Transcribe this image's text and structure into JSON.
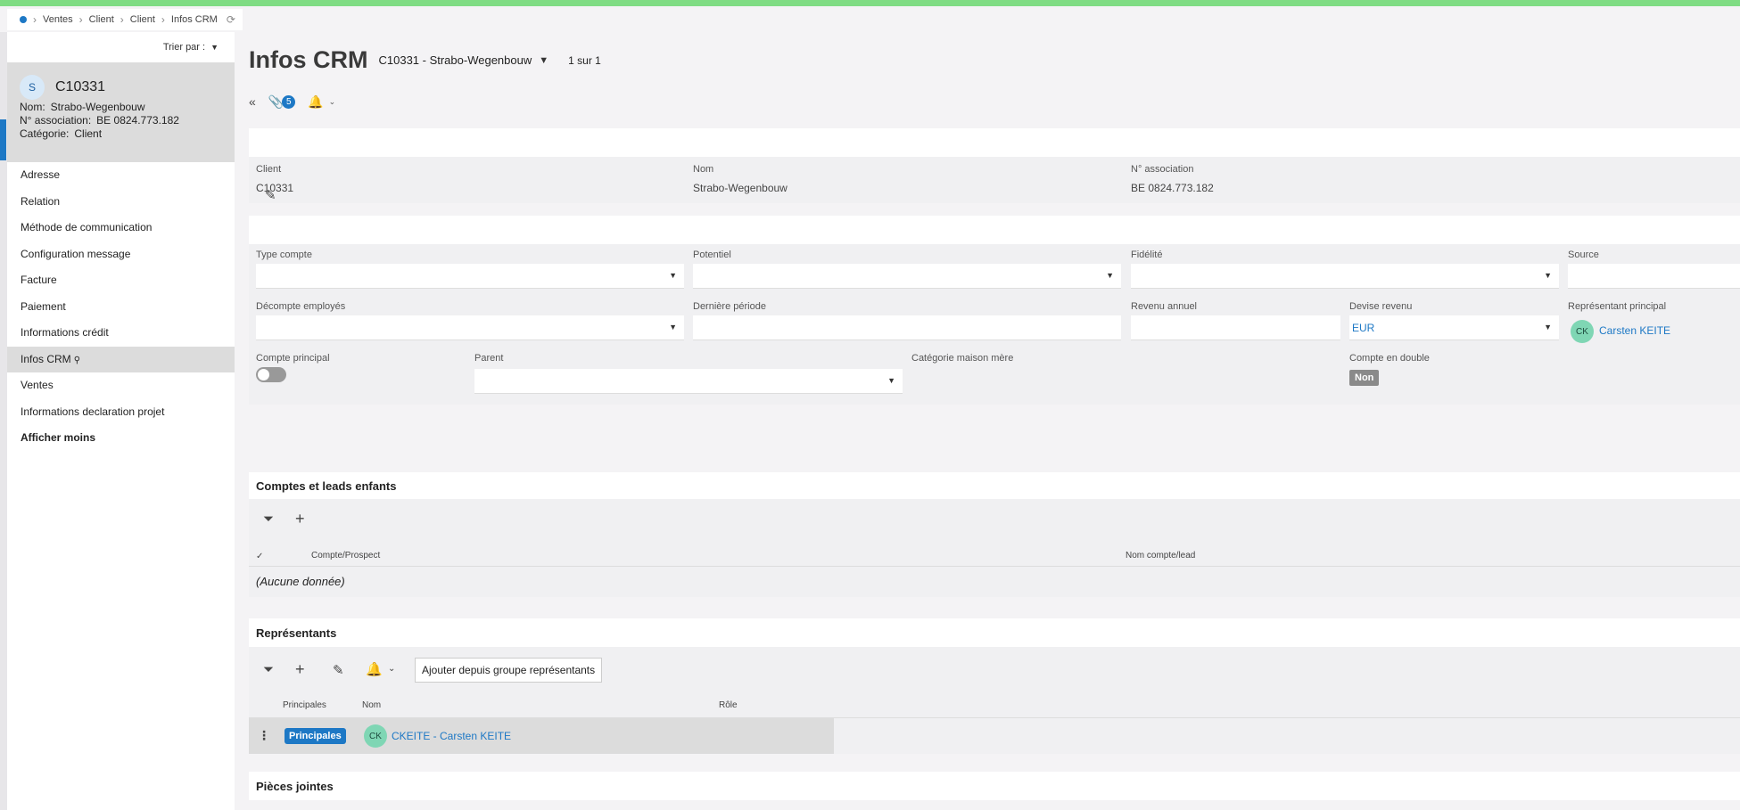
{
  "breadcrumb": [
    "Ventes",
    "Client",
    "Client",
    "Infos CRM"
  ],
  "sidebar": {
    "sort_label": "Trier par :",
    "card": {
      "avatar": "S",
      "code": "C10331",
      "rows": [
        {
          "key": "Nom:",
          "value": "Strabo-Wegenbouw"
        },
        {
          "key": "N° association:",
          "value": "BE 0824.773.182"
        },
        {
          "key": "Catégorie:",
          "value": "Client"
        }
      ]
    },
    "items": [
      {
        "label": "Adresse"
      },
      {
        "label": "Relation"
      },
      {
        "label": "Méthode de communication"
      },
      {
        "label": "Configuration message"
      },
      {
        "label": "Facture"
      },
      {
        "label": "Paiement"
      },
      {
        "label": "Informations crédit"
      },
      {
        "label": "Infos CRM"
      },
      {
        "label": "Ventes"
      },
      {
        "label": "Informations declaration projet"
      },
      {
        "label": "Afficher moins"
      }
    ]
  },
  "header": {
    "title": "Infos CRM",
    "record": "C10331 - Strabo-Wegenbouw",
    "pager": "1 sur 1",
    "attachments_count": "5"
  },
  "summary": {
    "fields": [
      {
        "label": "Client",
        "value": "C10331"
      },
      {
        "label": "Nom",
        "value": "Strabo-Wegenbouw"
      },
      {
        "label": "N° association",
        "value": "BE 0824.773.182"
      }
    ]
  },
  "form": {
    "type_compte": {
      "label": "Type compte",
      "value": ""
    },
    "potentiel": {
      "label": "Potentiel",
      "value": ""
    },
    "fidelite": {
      "label": "Fidélité",
      "value": ""
    },
    "source": {
      "label": "Source",
      "value": ""
    },
    "decompte": {
      "label": "Décompte employés",
      "value": ""
    },
    "derniere_periode": {
      "label": "Dernière période",
      "value": ""
    },
    "revenu_annuel": {
      "label": "Revenu annuel",
      "value": ""
    },
    "devise_revenu": {
      "label": "Devise revenu",
      "value": "EUR"
    },
    "representant_principal": {
      "label": "Représentant principal",
      "initials": "CK",
      "value": "Carsten KEITE"
    },
    "compte_principal": {
      "label": "Compte principal",
      "on": false
    },
    "parent": {
      "label": "Parent",
      "value": ""
    },
    "categorie_maison_mere": {
      "label": "Catégorie maison mère",
      "value": ""
    },
    "compte_double": {
      "label": "Compte en double",
      "value": "Non"
    }
  },
  "children_section": {
    "title": "Comptes et leads enfants",
    "columns": [
      "Compte/Prospect",
      "Nom compte/lead"
    ],
    "empty": "(Aucune donnée)"
  },
  "reps_section": {
    "title": "Représentants",
    "add_group_button": "Ajouter depuis groupe représentants",
    "columns": [
      "Principales",
      "Nom",
      "Rôle"
    ],
    "rows": [
      {
        "tag": "Principales",
        "initials": "CK",
        "name": "CKEITE - Carsten KEITE",
        "role": ""
      }
    ]
  },
  "attachments_section": {
    "title": "Pièces jointes"
  },
  "colors": {
    "accent": "#1d78c5",
    "topbar": "#7fdc83",
    "avatar_green": "#7fd6b4"
  }
}
